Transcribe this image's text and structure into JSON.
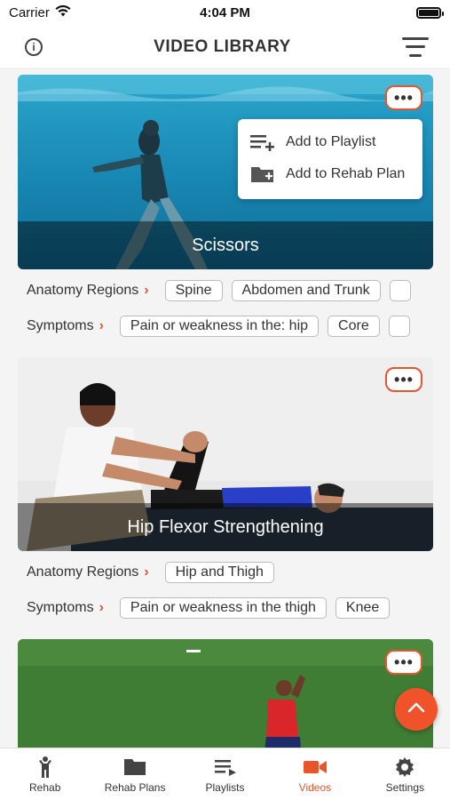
{
  "status": {
    "carrier": "Carrier",
    "time": "4:04 PM"
  },
  "header": {
    "title": "VIDEO LIBRARY",
    "info_icon": "i"
  },
  "more_label": "•••",
  "popup": {
    "items": [
      "Add to Playlist",
      "Add to Rehab Plan"
    ]
  },
  "videos": [
    {
      "title": "Scissors",
      "anatomy_label": "Anatomy Regions",
      "anatomy_tags": [
        "Spine",
        "Abdomen and Trunk"
      ],
      "symptoms_label": "Symptoms",
      "symptom_tags": [
        "Pain or weakness in the: hip",
        "Core"
      ]
    },
    {
      "title": "Hip Flexor Strengthening",
      "anatomy_label": "Anatomy Regions",
      "anatomy_tags": [
        "Hip and Thigh"
      ],
      "symptoms_label": "Symptoms",
      "symptom_tags": [
        "Pain or weakness in the thigh",
        "Knee"
      ]
    }
  ],
  "chevron": "›",
  "tabs": [
    {
      "label": "Rehab",
      "icon": "person-icon"
    },
    {
      "label": "Rehab Plans",
      "icon": "folder-icon"
    },
    {
      "label": "Playlists",
      "icon": "playlist-icon"
    },
    {
      "label": "Videos",
      "icon": "video-camera-icon",
      "active": true
    },
    {
      "label": "Settings",
      "icon": "gear-icon"
    }
  ],
  "colors": {
    "accent": "#e8542b",
    "pool": "#1a8fb8",
    "grass": "#3f7d34"
  }
}
